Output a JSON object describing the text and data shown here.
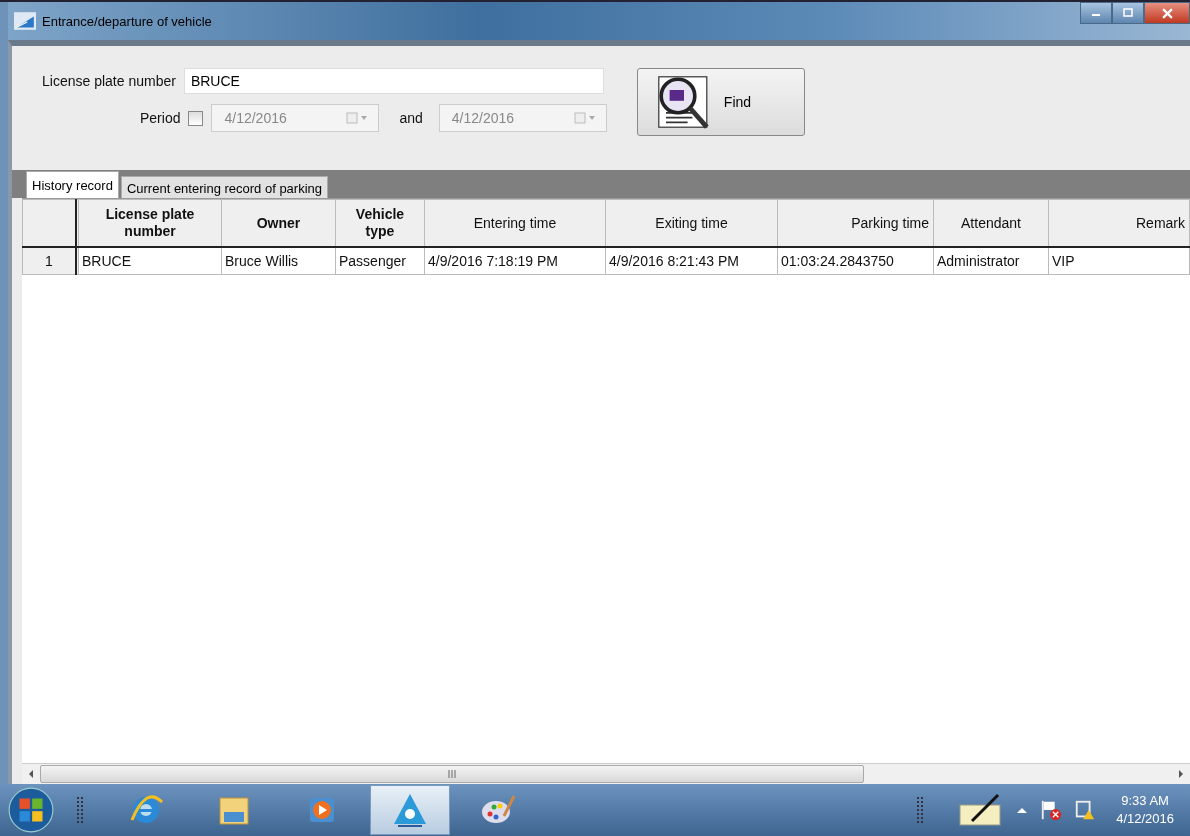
{
  "window": {
    "title": "Entrance/departure of vehicle"
  },
  "search": {
    "plate_label": "License plate number",
    "plate_value": "BRUCE",
    "period_label": "Period",
    "period_checked": false,
    "date_from": {
      "value": "4/12/2016",
      "disabled": true
    },
    "and_label": "and",
    "date_to": {
      "value": "4/12/2016",
      "disabled": true
    },
    "find_button": "Find"
  },
  "tabs": [
    {
      "label": "History record",
      "selected": true
    },
    {
      "label": "Current entering record of parking",
      "selected": false
    }
  ],
  "table": {
    "columns": [
      {
        "label": "License plate number",
        "bold": true,
        "kind": "center"
      },
      {
        "label": "Owner",
        "bold": true,
        "kind": "center"
      },
      {
        "label": "Vehicle type",
        "bold": true,
        "kind": "center"
      },
      {
        "label": "Entering time",
        "bold": false,
        "kind": "center"
      },
      {
        "label": "Exiting time",
        "bold": false,
        "kind": "center"
      },
      {
        "label": "Parking time",
        "bold": false,
        "kind": "right"
      },
      {
        "label": "Attendant",
        "bold": false,
        "kind": "center"
      },
      {
        "label": "Remark",
        "bold": false,
        "kind": "right"
      }
    ],
    "rows": [
      {
        "number": "1",
        "cells": [
          "BRUCE",
          "Bruce Willis",
          "Passenger",
          "4/9/2016 7:18:19 PM",
          "4/9/2016 8:21:43 PM",
          "01:03:24.2843750",
          "Administrator",
          "VIP"
        ]
      }
    ]
  },
  "taskbar": {
    "apps": [
      {
        "kind": "browser",
        "active": false
      },
      {
        "kind": "folder",
        "active": false
      },
      {
        "kind": "media",
        "active": false
      },
      {
        "kind": "app",
        "active": true
      },
      {
        "kind": "paint",
        "active": false
      }
    ],
    "clock": {
      "time": "9:33 AM",
      "date": "4/12/2016"
    }
  }
}
